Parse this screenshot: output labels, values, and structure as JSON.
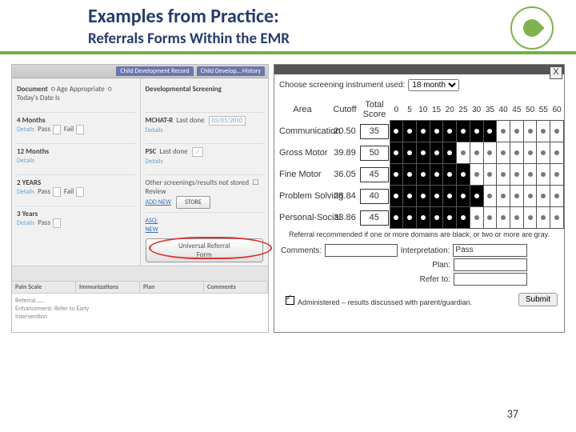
{
  "slide": {
    "title": "Examples from Practice:",
    "subtitle": "Referrals Forms Within the EMR",
    "page_number": "37"
  },
  "emr": {
    "tabs": [
      "Child Development Record",
      "Child Develop… History"
    ],
    "doc_label": "Document",
    "opt_age": "Age Appropriate",
    "opt_today": "Today's Date Is",
    "details": "Details",
    "pass_label": "Pass",
    "fail_label": "Fail",
    "ages": {
      "a1": "4 Months",
      "a2": "12 Months",
      "a3": "2 YEARS",
      "a4": "3 Years"
    },
    "dev_header": "Developmental Screening",
    "mchat": "MCHAT-R",
    "last_done": "Last done",
    "psc": "PSC",
    "other": "Other screenings/results not stored",
    "review": "Review",
    "add_new": "ADD NEW",
    "store": "STORE",
    "asq_new": "ASQ:\nNEW",
    "ref_form": "Universal Referral Form",
    "footer": {
      "c1": "Pain Scale",
      "c2": "Immunizations",
      "c3": "Plan",
      "c4": "Comments"
    }
  },
  "asq": {
    "choose_label": "Choose screening instrument used:",
    "choose_value": "18 month",
    "close": "X",
    "headers": {
      "area": "Area",
      "cutoff": "Cutoff",
      "total": "Total\nScore"
    },
    "ticks": [
      "0",
      "5",
      "10",
      "15",
      "20",
      "25",
      "30",
      "35",
      "40",
      "45",
      "50",
      "55",
      "60"
    ],
    "rows": [
      {
        "name": "Communication",
        "cutoff": "20.50",
        "score": "35",
        "black": 8
      },
      {
        "name": "Gross Motor",
        "cutoff": "39.89",
        "score": "50",
        "black": 5
      },
      {
        "name": "Fine Motor",
        "cutoff": "36.05",
        "score": "45",
        "black": 6
      },
      {
        "name": "Problem Solving",
        "cutoff": "28.84",
        "score": "40",
        "black": 7
      },
      {
        "name": "Personal-Social",
        "cutoff": "33.86",
        "score": "45",
        "black": 6
      }
    ],
    "reco": "Referral recommended if one or more domains are black, or two or more are gray.",
    "comments": "Comments:",
    "interpretation": "Interpretation:",
    "interp_val": "Pass",
    "plan": "Plan:",
    "refer": "Refer to:",
    "admin": "Administered – results discussed with parent/guardian.",
    "submit": "Submit"
  }
}
